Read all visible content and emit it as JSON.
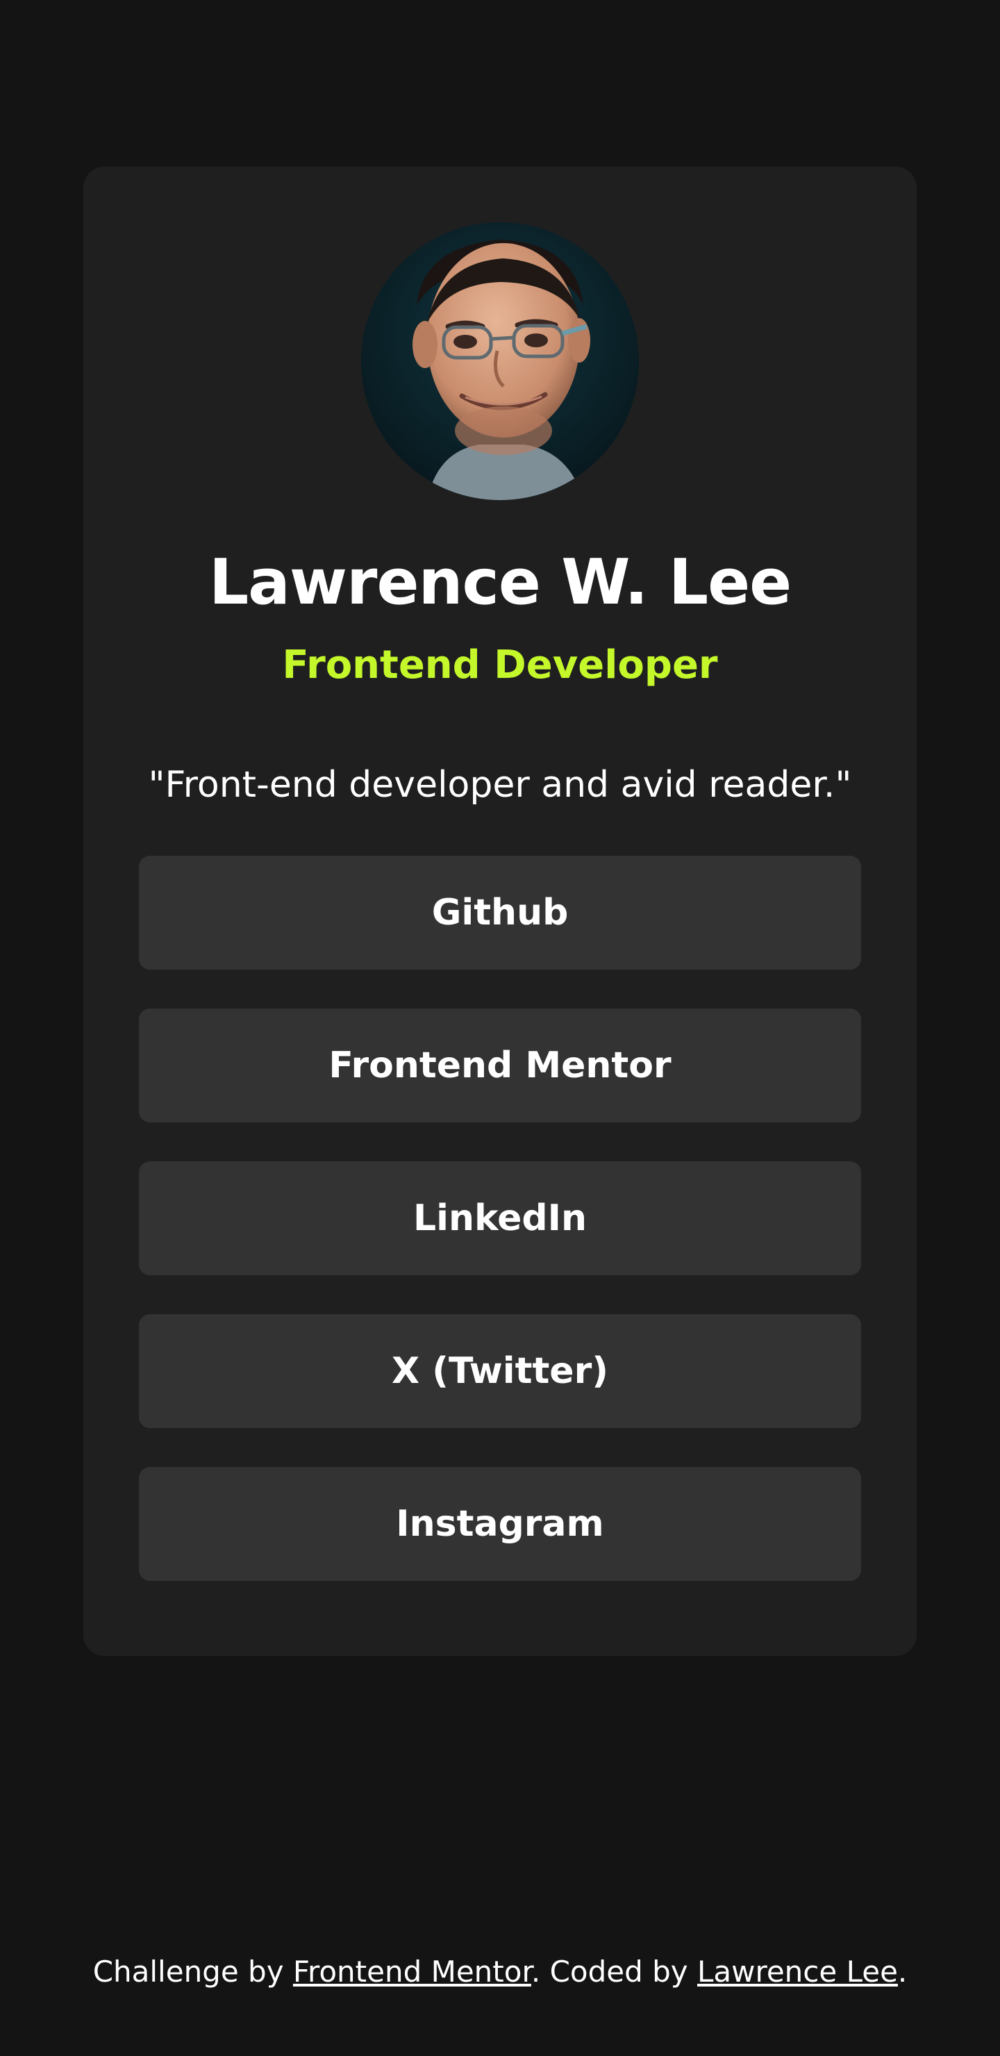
{
  "profile": {
    "name": "Lawrence W. Lee",
    "role": "Frontend Developer",
    "bio": "\"Front-end developer and avid reader.\""
  },
  "links": [
    {
      "label": "Github"
    },
    {
      "label": "Frontend Mentor"
    },
    {
      "label": "LinkedIn"
    },
    {
      "label": "X (Twitter)"
    },
    {
      "label": "Instagram"
    }
  ],
  "footer": {
    "prefix": "Challenge by ",
    "challenge_link": "Frontend Mentor",
    "middle": ". Coded by ",
    "author_link": "Lawrence Lee",
    "suffix": "."
  },
  "colors": {
    "page_background": "#141414",
    "card_background": "#1f1f1f",
    "button_background": "#333333",
    "accent": "#c4f82a",
    "text": "#ffffff"
  }
}
